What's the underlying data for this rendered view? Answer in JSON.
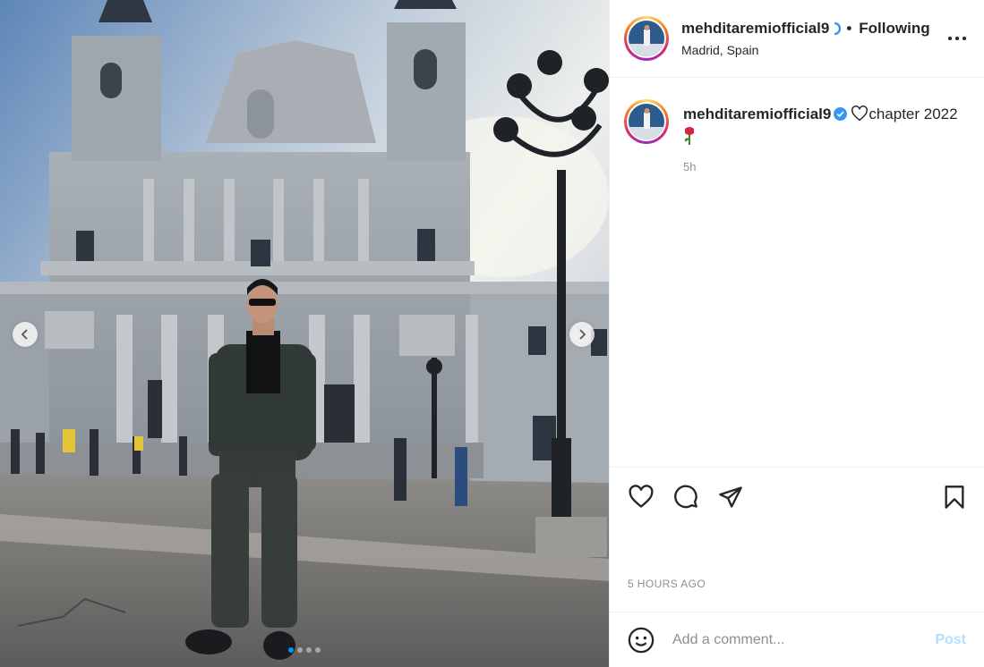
{
  "media": {
    "slides_total": 4,
    "active_slide": 1,
    "prev_icon": "chevron-left-icon",
    "next_icon": "chevron-right-icon"
  },
  "header": {
    "username": "mehditaremiofficial9",
    "separator": "•",
    "follow_state": "Following",
    "location": "Madrid, Spain",
    "more_icon": "more-horizontal-icon"
  },
  "caption": {
    "username": "mehditaremiofficial9",
    "text": "chapter 2022",
    "time": "5h",
    "verified_icon": "verified-badge-icon",
    "heart_icon": "heart-outline-icon",
    "rose_icon": "rose-emoji-icon"
  },
  "actions": {
    "like_icon": "heart-icon",
    "comment_icon": "comment-icon",
    "share_icon": "share-icon",
    "save_icon": "bookmark-icon"
  },
  "timestamp": "5 HOURS AGO",
  "comment_box": {
    "placeholder": "Add a comment...",
    "post_label": "Post",
    "emoji_icon": "emoji-icon"
  },
  "colors": {
    "accent": "#0095f6",
    "post_disabled": "#b2dffc",
    "muted": "#8e8e8e",
    "text": "#262626",
    "border": "#efefef"
  }
}
